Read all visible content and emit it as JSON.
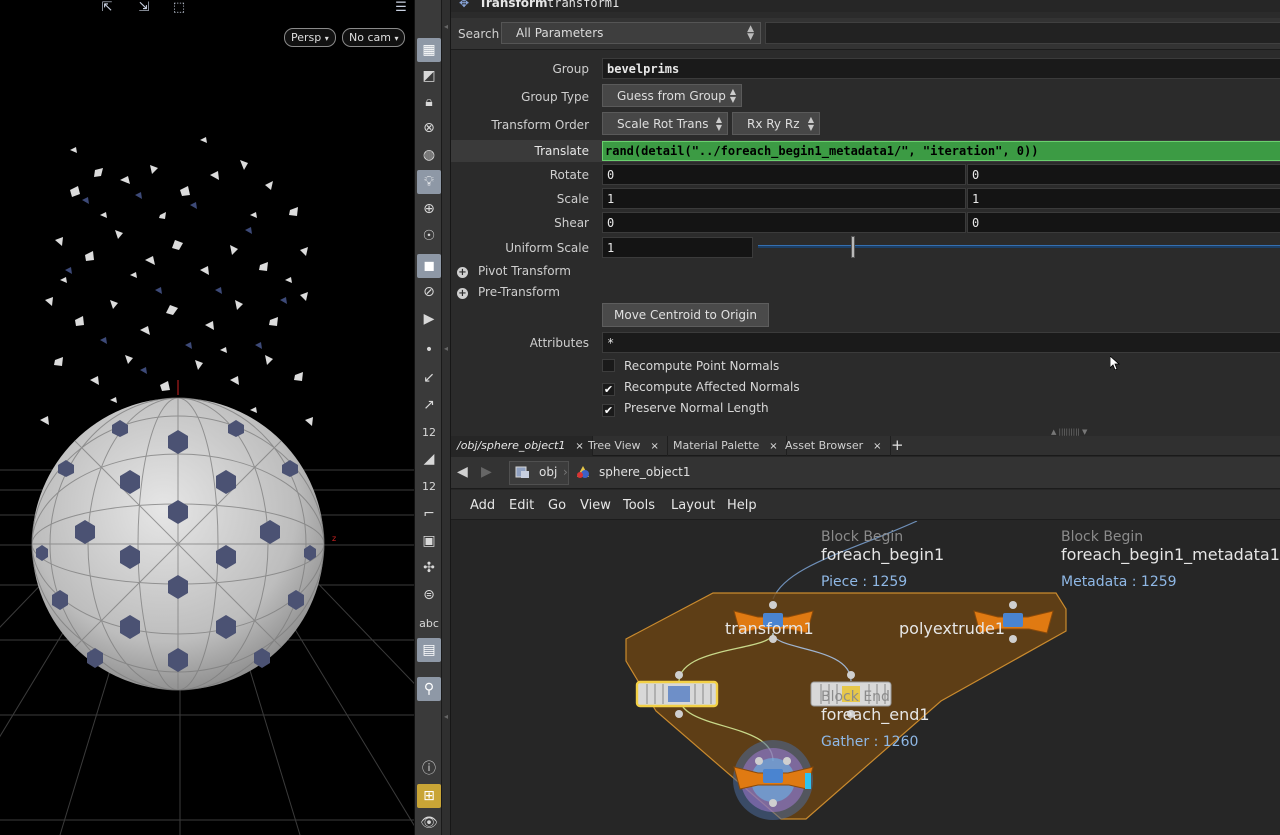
{
  "viewport": {
    "camera_menu": "Persp",
    "cam_menu": "No cam",
    "help_glyph": "?"
  },
  "shelf": {
    "tool_text_abc": "abc",
    "tool_text_12": "12"
  },
  "param_header": {
    "node_type": "Transform",
    "node_name": "transform1"
  },
  "search": {
    "label": "Search",
    "filter_value": "All Parameters"
  },
  "params": {
    "group": {
      "label": "Group",
      "value": "bevelprims"
    },
    "group_type": {
      "label": "Group Type",
      "value": "Guess from Group"
    },
    "transform_order": {
      "label": "Transform Order",
      "value": "Scale Rot Trans",
      "rot_value": "Rx Ry Rz"
    },
    "translate": {
      "label": "Translate",
      "value": "rand(detail(\"../foreach_begin1_metadata1/\", \"iteration\", 0))"
    },
    "rotate": {
      "label": "Rotate",
      "x": "0",
      "y": "0"
    },
    "scale": {
      "label": "Scale",
      "x": "1",
      "y": "1"
    },
    "shear": {
      "label": "Shear",
      "x": "0",
      "y": "0"
    },
    "uniform_scale": {
      "label": "Uniform Scale",
      "value": "1",
      "slider_fraction": 0.18
    },
    "pivot_transform": "Pivot Transform",
    "pre_transform": "Pre-Transform",
    "move_centroid": "Move Centroid to Origin",
    "attributes": {
      "label": "Attributes",
      "value": "*"
    },
    "recompute_point_normals": {
      "label": "Recompute Point Normals",
      "checked": false
    },
    "recompute_affected_normals": {
      "label": "Recompute Affected Normals",
      "checked": true
    },
    "preserve_normal_length": {
      "label": "Preserve Normal Length",
      "checked": true
    }
  },
  "network": {
    "tabs": [
      {
        "label": "/obj/sphere_object1"
      },
      {
        "label": "Tree View"
      },
      {
        "label": "Material Palette"
      },
      {
        "label": "Asset Browser"
      }
    ],
    "tab_close": "×",
    "tab_add": "+",
    "path": {
      "root": "obj",
      "child": "sphere_object1"
    },
    "menu": [
      "Add",
      "Edit",
      "Go",
      "View",
      "Tools",
      "Layout",
      "Help"
    ],
    "nodes": {
      "foreach_begin1": {
        "type_label": "Block Begin",
        "name": "foreach_begin1",
        "info": "Piece : 1259"
      },
      "foreach_begin1_metadata1": {
        "type_label": "Block Begin",
        "name": "foreach_begin1_metadata1",
        "info": "Metadata : 1259"
      },
      "transform1": {
        "name": "transform1"
      },
      "polyextrude1": {
        "name": "polyextrude1"
      },
      "foreach_end1": {
        "type_label": "Block End",
        "name": "foreach_end1",
        "info": "Gather : 1260"
      }
    }
  },
  "colors": {
    "expression_green": "#3c9b44",
    "block_fill": "#6b4414",
    "block_border": "#c98a2e",
    "node_orange": "#e07a12",
    "selection_yellow": "#f2d046",
    "info_blue": "#8fb8e6"
  }
}
